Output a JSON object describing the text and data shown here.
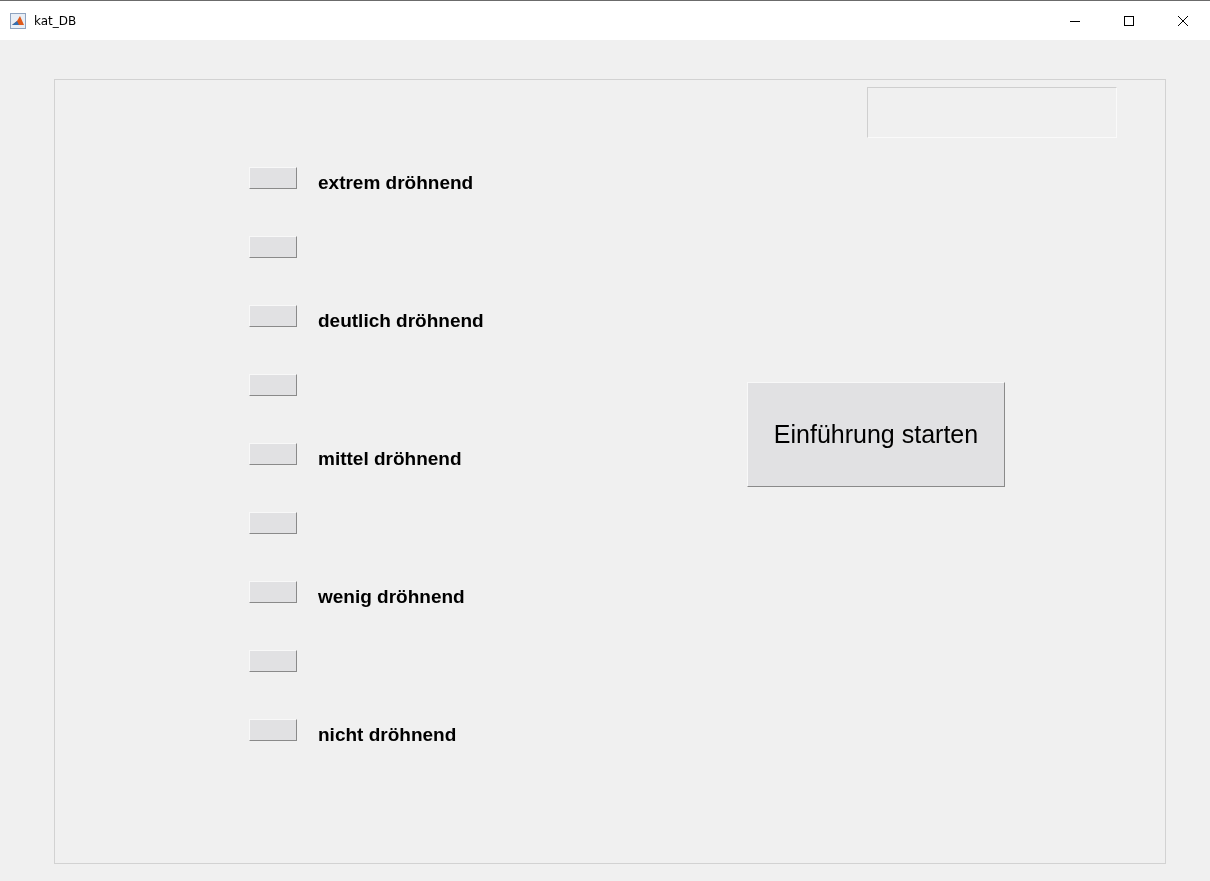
{
  "window": {
    "title": "kat_DB"
  },
  "panel": {
    "answer_field": {
      "kind": "text-field"
    }
  },
  "scale": [
    {
      "kind": "labeled",
      "label": "extrem dröhnend"
    },
    {
      "kind": "plain"
    },
    {
      "kind": "labeled",
      "label": "deutlich dröhnend"
    },
    {
      "kind": "plain"
    },
    {
      "kind": "labeled",
      "label": "mittel dröhnend"
    },
    {
      "kind": "plain"
    },
    {
      "kind": "labeled",
      "label": "wenig dröhnend"
    },
    {
      "kind": "plain"
    },
    {
      "kind": "labeled",
      "label": "nicht dröhnend"
    }
  ],
  "start_button": {
    "label": "Einführung starten"
  }
}
